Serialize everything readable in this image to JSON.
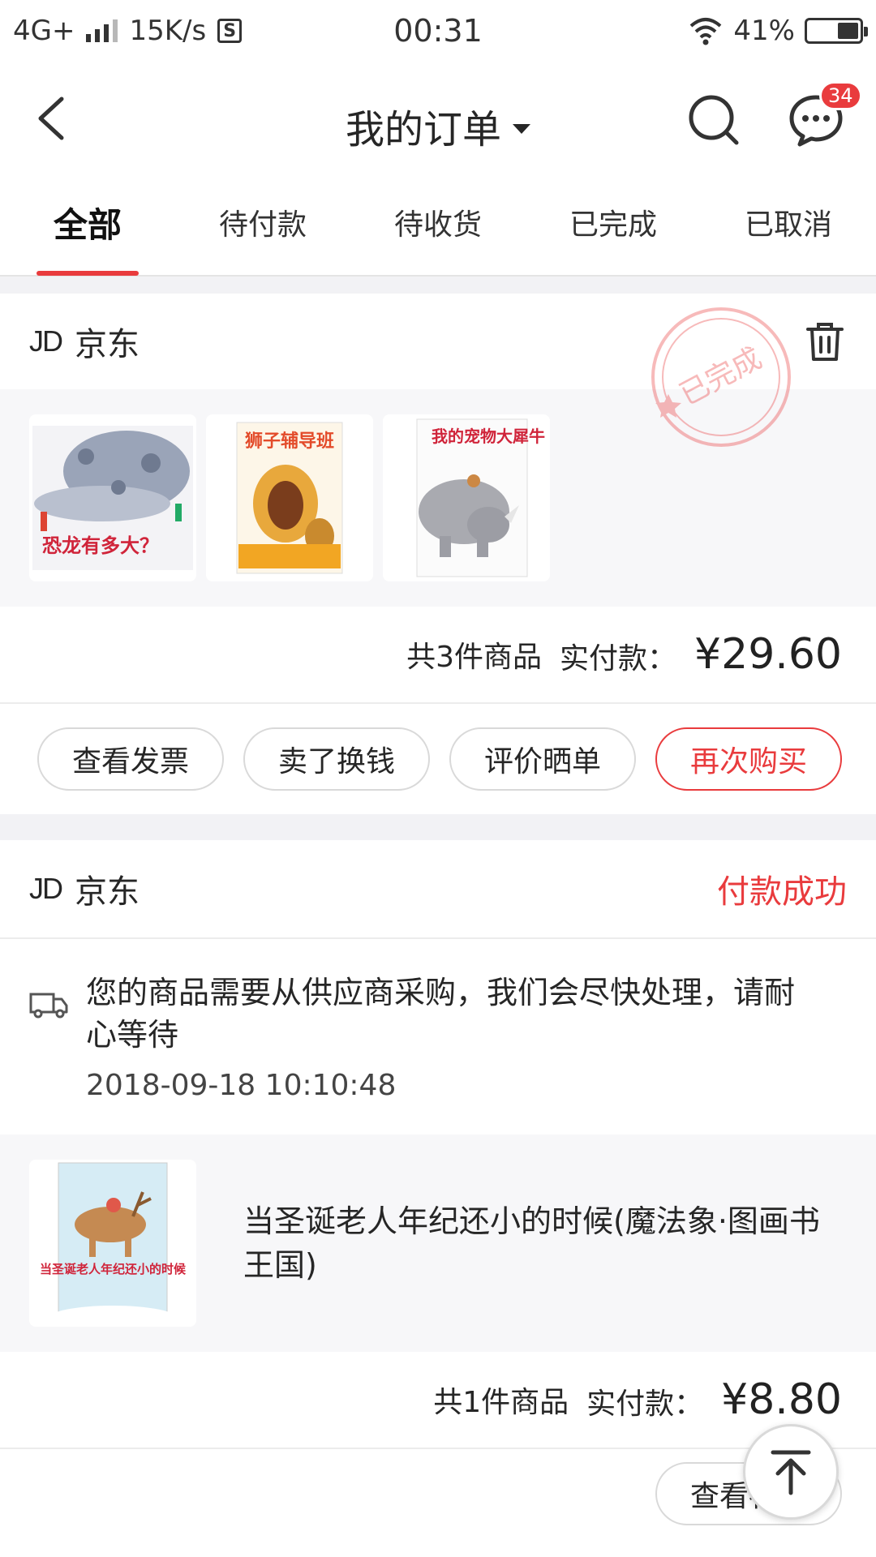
{
  "statusbar": {
    "network": "4G+",
    "speed": "15K/s",
    "s_icon": "S",
    "time": "00:31",
    "battery": "41%",
    "battery_level": 0.41
  },
  "header": {
    "title": "我的订单",
    "message_badge": "34"
  },
  "tabs": [
    "全部",
    "待付款",
    "待收货",
    "已完成",
    "已取消"
  ],
  "orders": [
    {
      "shop": "京东",
      "stamp": "已完成",
      "covers": [
        {
          "title": "恐龙有多大？"
        },
        {
          "title": "狮子辅导班"
        },
        {
          "title": "我的宠物大犀牛"
        }
      ],
      "summary": "共3件商品",
      "paid_label": "实付款：",
      "price": "¥29.60",
      "buttons": [
        "查看发票",
        "卖了换钱",
        "评价晒单",
        "再次购买"
      ]
    },
    {
      "shop": "京东",
      "status": "付款成功",
      "logistics_text": "您的商品需要从供应商采购，我们会尽快处理，请耐心等待",
      "logistics_time": "2018-09-18 10:10:48",
      "cover_title": "当圣诞老人年纪还小的时候",
      "product_title": "当圣诞老人年纪还小的时候(魔法象·图画书王国)",
      "summary": "共1件商品",
      "paid_label": "实付款：",
      "price": "¥8.80",
      "buttons": [
        "查看物流"
      ]
    }
  ],
  "colors": {
    "accent": "#e93b3d",
    "background": "#f2f2f5"
  }
}
